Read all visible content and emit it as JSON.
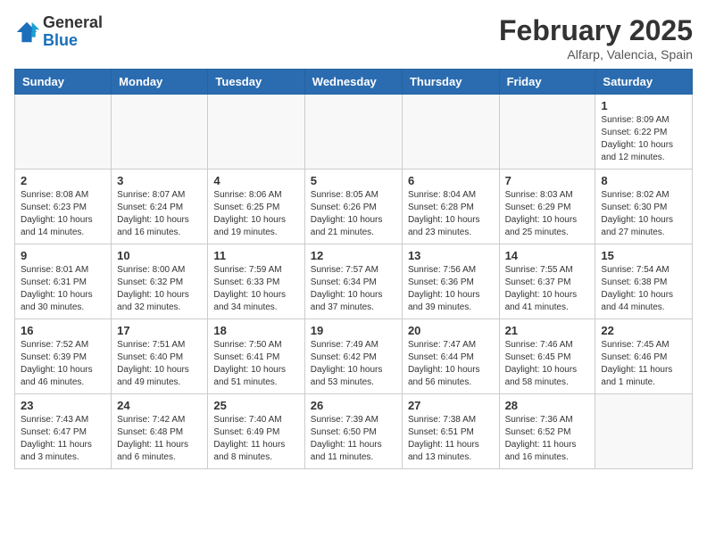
{
  "header": {
    "logo_line1": "General",
    "logo_line2": "Blue",
    "month": "February 2025",
    "location": "Alfarp, Valencia, Spain"
  },
  "weekdays": [
    "Sunday",
    "Monday",
    "Tuesday",
    "Wednesday",
    "Thursday",
    "Friday",
    "Saturday"
  ],
  "weeks": [
    [
      {
        "day": "",
        "info": ""
      },
      {
        "day": "",
        "info": ""
      },
      {
        "day": "",
        "info": ""
      },
      {
        "day": "",
        "info": ""
      },
      {
        "day": "",
        "info": ""
      },
      {
        "day": "",
        "info": ""
      },
      {
        "day": "1",
        "info": "Sunrise: 8:09 AM\nSunset: 6:22 PM\nDaylight: 10 hours\nand 12 minutes."
      }
    ],
    [
      {
        "day": "2",
        "info": "Sunrise: 8:08 AM\nSunset: 6:23 PM\nDaylight: 10 hours\nand 14 minutes."
      },
      {
        "day": "3",
        "info": "Sunrise: 8:07 AM\nSunset: 6:24 PM\nDaylight: 10 hours\nand 16 minutes."
      },
      {
        "day": "4",
        "info": "Sunrise: 8:06 AM\nSunset: 6:25 PM\nDaylight: 10 hours\nand 19 minutes."
      },
      {
        "day": "5",
        "info": "Sunrise: 8:05 AM\nSunset: 6:26 PM\nDaylight: 10 hours\nand 21 minutes."
      },
      {
        "day": "6",
        "info": "Sunrise: 8:04 AM\nSunset: 6:28 PM\nDaylight: 10 hours\nand 23 minutes."
      },
      {
        "day": "7",
        "info": "Sunrise: 8:03 AM\nSunset: 6:29 PM\nDaylight: 10 hours\nand 25 minutes."
      },
      {
        "day": "8",
        "info": "Sunrise: 8:02 AM\nSunset: 6:30 PM\nDaylight: 10 hours\nand 27 minutes."
      }
    ],
    [
      {
        "day": "9",
        "info": "Sunrise: 8:01 AM\nSunset: 6:31 PM\nDaylight: 10 hours\nand 30 minutes."
      },
      {
        "day": "10",
        "info": "Sunrise: 8:00 AM\nSunset: 6:32 PM\nDaylight: 10 hours\nand 32 minutes."
      },
      {
        "day": "11",
        "info": "Sunrise: 7:59 AM\nSunset: 6:33 PM\nDaylight: 10 hours\nand 34 minutes."
      },
      {
        "day": "12",
        "info": "Sunrise: 7:57 AM\nSunset: 6:34 PM\nDaylight: 10 hours\nand 37 minutes."
      },
      {
        "day": "13",
        "info": "Sunrise: 7:56 AM\nSunset: 6:36 PM\nDaylight: 10 hours\nand 39 minutes."
      },
      {
        "day": "14",
        "info": "Sunrise: 7:55 AM\nSunset: 6:37 PM\nDaylight: 10 hours\nand 41 minutes."
      },
      {
        "day": "15",
        "info": "Sunrise: 7:54 AM\nSunset: 6:38 PM\nDaylight: 10 hours\nand 44 minutes."
      }
    ],
    [
      {
        "day": "16",
        "info": "Sunrise: 7:52 AM\nSunset: 6:39 PM\nDaylight: 10 hours\nand 46 minutes."
      },
      {
        "day": "17",
        "info": "Sunrise: 7:51 AM\nSunset: 6:40 PM\nDaylight: 10 hours\nand 49 minutes."
      },
      {
        "day": "18",
        "info": "Sunrise: 7:50 AM\nSunset: 6:41 PM\nDaylight: 10 hours\nand 51 minutes."
      },
      {
        "day": "19",
        "info": "Sunrise: 7:49 AM\nSunset: 6:42 PM\nDaylight: 10 hours\nand 53 minutes."
      },
      {
        "day": "20",
        "info": "Sunrise: 7:47 AM\nSunset: 6:44 PM\nDaylight: 10 hours\nand 56 minutes."
      },
      {
        "day": "21",
        "info": "Sunrise: 7:46 AM\nSunset: 6:45 PM\nDaylight: 10 hours\nand 58 minutes."
      },
      {
        "day": "22",
        "info": "Sunrise: 7:45 AM\nSunset: 6:46 PM\nDaylight: 11 hours\nand 1 minute."
      }
    ],
    [
      {
        "day": "23",
        "info": "Sunrise: 7:43 AM\nSunset: 6:47 PM\nDaylight: 11 hours\nand 3 minutes."
      },
      {
        "day": "24",
        "info": "Sunrise: 7:42 AM\nSunset: 6:48 PM\nDaylight: 11 hours\nand 6 minutes."
      },
      {
        "day": "25",
        "info": "Sunrise: 7:40 AM\nSunset: 6:49 PM\nDaylight: 11 hours\nand 8 minutes."
      },
      {
        "day": "26",
        "info": "Sunrise: 7:39 AM\nSunset: 6:50 PM\nDaylight: 11 hours\nand 11 minutes."
      },
      {
        "day": "27",
        "info": "Sunrise: 7:38 AM\nSunset: 6:51 PM\nDaylight: 11 hours\nand 13 minutes."
      },
      {
        "day": "28",
        "info": "Sunrise: 7:36 AM\nSunset: 6:52 PM\nDaylight: 11 hours\nand 16 minutes."
      },
      {
        "day": "",
        "info": ""
      }
    ]
  ]
}
